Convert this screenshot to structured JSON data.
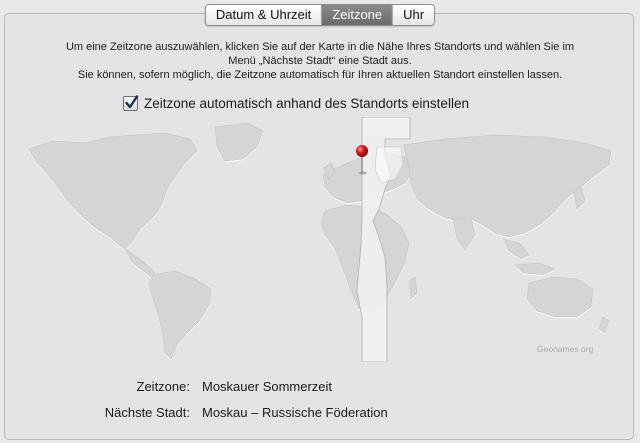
{
  "tabs": [
    {
      "label": "Datum & Uhrzeit",
      "active": false
    },
    {
      "label": "Zeitzone",
      "active": true
    },
    {
      "label": "Uhr",
      "active": false
    }
  ],
  "intro": {
    "line1": "Um eine Zeitzone auszuwählen, klicken Sie auf der Karte in die Nähe Ihres Standorts und wählen Sie im",
    "line2": "Menü „Nächste Stadt“ eine Stadt aus.",
    "line3": "Sie können, sofern möglich, die Zeitzone automatisch für Ihren aktuellen Standort einstellen lassen."
  },
  "auto_timezone": {
    "label": "Zeitzone automatisch anhand des Standorts einstellen",
    "checked": true
  },
  "map": {
    "credit": "Geonames.org",
    "pin_color": "#d81e1e"
  },
  "info": {
    "timezone_label": "Zeitzone:",
    "timezone_value": "Moskauer Sommerzeit",
    "city_label": "Nächste Stadt:",
    "city_value": "Moskau – Russische Föderation"
  }
}
